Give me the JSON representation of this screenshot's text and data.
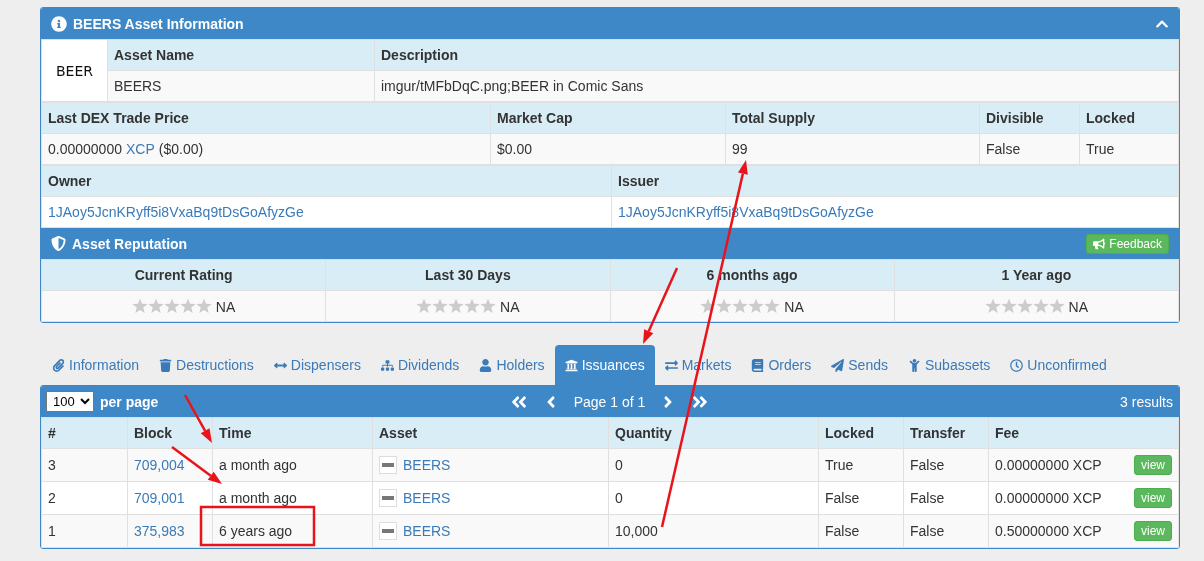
{
  "asset_panel": {
    "title": "BEERS Asset Information",
    "logo_text": "BEER",
    "name_header": "Asset Name",
    "name": "BEERS",
    "description_header": "Description",
    "description": "imgur/tMFbDqC.png;BEER in Comic Sans",
    "price_header": "Last DEX Trade Price",
    "price_amount": "0.00000000",
    "price_unit": "XCP",
    "price_usd": "($0.00)",
    "market_cap_header": "Market Cap",
    "market_cap": "$0.00",
    "supply_header": "Total Supply",
    "supply": "99",
    "divisible_header": "Divisible",
    "divisible": "False",
    "locked_header": "Locked",
    "locked": "True",
    "owner_header": "Owner",
    "owner": "1JAoy5JcnKRyff5i8VxaBq9tDsGoAfyzGe",
    "issuer_header": "Issuer",
    "issuer": "1JAoy5JcnKRyff5i8VxaBq9tDsGoAfyzGe"
  },
  "reputation": {
    "title": "Asset Reputation",
    "feedback_button": "Feedback",
    "periods": [
      {
        "label": "Current Rating",
        "stars": 0,
        "value": "NA"
      },
      {
        "label": "Last 30 Days",
        "stars": 0,
        "value": "NA"
      },
      {
        "label": "6 months ago",
        "stars": 0,
        "value": "NA"
      },
      {
        "label": "1 Year ago",
        "stars": 0,
        "value": "NA"
      }
    ]
  },
  "tabs": [
    {
      "label": "Information",
      "selected": false
    },
    {
      "label": "Destructions",
      "selected": false
    },
    {
      "label": "Dispensers",
      "selected": false
    },
    {
      "label": "Dividends",
      "selected": false
    },
    {
      "label": "Holders",
      "selected": false
    },
    {
      "label": "Issuances",
      "selected": true
    },
    {
      "label": "Markets",
      "selected": false
    },
    {
      "label": "Orders",
      "selected": false
    },
    {
      "label": "Sends",
      "selected": false
    },
    {
      "label": "Subassets",
      "selected": false
    },
    {
      "label": "Unconfirmed",
      "selected": false
    }
  ],
  "issuances": {
    "per_page_value": "100",
    "per_page_label": "per page",
    "page_label": "Page 1 of 1",
    "results": "3 results",
    "columns": [
      "#",
      "Block",
      "Time",
      "Asset",
      "Quantity",
      "Locked",
      "Transfer",
      "Fee"
    ],
    "rows": [
      {
        "index": "3",
        "block": "709,004",
        "time": "a month ago",
        "asset": "BEERS",
        "quantity": "0",
        "locked": "True",
        "transfer": "False",
        "fee": "0.00000000 XCP",
        "action": "view"
      },
      {
        "index": "2",
        "block": "709,001",
        "time": "a month ago",
        "asset": "BEERS",
        "quantity": "0",
        "locked": "False",
        "transfer": "False",
        "fee": "0.00000000 XCP",
        "action": "view"
      },
      {
        "index": "1",
        "block": "375,983",
        "time": "6 years ago",
        "asset": "BEERS",
        "quantity": "10,000",
        "locked": "False",
        "transfer": "False",
        "fee": "0.50000000 XCP",
        "action": "view"
      }
    ]
  },
  "annotations": [
    {
      "kind": "arrow"
    },
    {
      "kind": "arrow"
    },
    {
      "kind": "arrow"
    },
    {
      "kind": "arrow"
    },
    {
      "kind": "box"
    }
  ]
}
